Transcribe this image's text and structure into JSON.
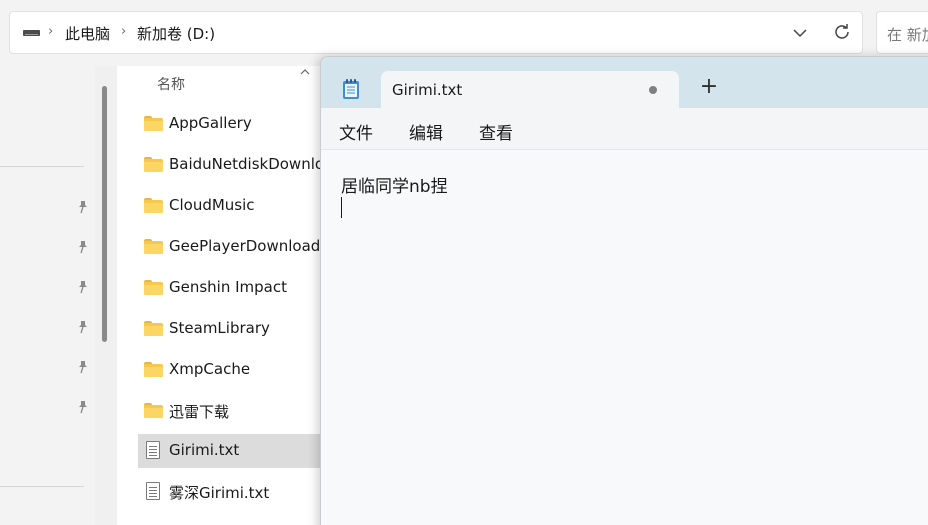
{
  "address_bar": {
    "breadcrumbs": [
      "此电脑",
      "新加卷 (D:)"
    ],
    "search_placeholder": "在 新加"
  },
  "file_list": {
    "column_header": "名称",
    "items": [
      {
        "name": "AppGallery",
        "type": "folder"
      },
      {
        "name": "BaiduNetdiskDownlo",
        "type": "folder"
      },
      {
        "name": "CloudMusic",
        "type": "folder"
      },
      {
        "name": "GeePlayerDownload",
        "type": "folder"
      },
      {
        "name": "Genshin Impact",
        "type": "folder"
      },
      {
        "name": "SteamLibrary",
        "type": "folder"
      },
      {
        "name": "XmpCache",
        "type": "folder"
      },
      {
        "name": "迅雷下载",
        "type": "folder"
      },
      {
        "name": "Girimi.txt",
        "type": "text-file",
        "selected": true
      },
      {
        "name": "雾深Girimi.txt",
        "type": "text-file"
      }
    ]
  },
  "notepad": {
    "tab_title": "Girimi.txt",
    "new_tab_symbol": "+",
    "menu": [
      "文件",
      "编辑",
      "查看"
    ],
    "content": "居临同学nb捏"
  },
  "icons": {
    "address": [
      "drive-icon",
      "chevron-right-icon",
      "chevron-down-icon",
      "refresh-icon"
    ],
    "nav": [
      "pin-icon"
    ],
    "notepad": [
      "notepad-app-icon",
      "unsaved-dot-icon",
      "plus-icon"
    ]
  },
  "colors": {
    "folder": "#f6c84e",
    "titlebar": "#d4e4ec",
    "selection": "#dcdcdc"
  }
}
